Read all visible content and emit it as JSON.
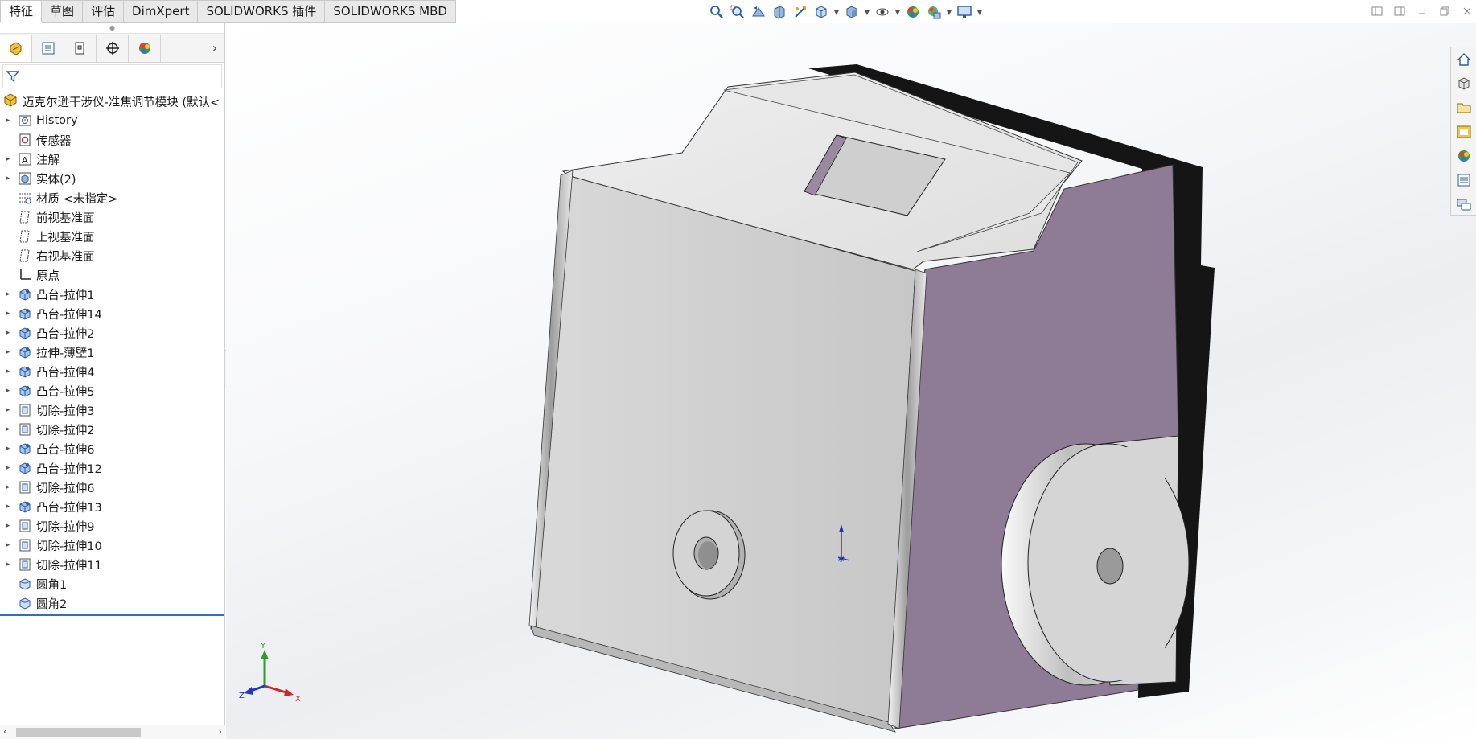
{
  "tabs": [
    "特征",
    "草图",
    "评估",
    "DimXpert",
    "SOLIDWORKS 插件",
    "SOLIDWORKS MBD"
  ],
  "active_tab": "特征",
  "view_toolbar": {
    "icons": [
      "zoom-to-fit-icon",
      "zoom-to-area-icon",
      "previous-view-icon",
      "section-view-icon",
      "dynamic-annotation-icon",
      "view-orientation-icon",
      "display-style-icon",
      "hide-show-items-icon",
      "edit-appearance-icon",
      "apply-scene-icon",
      "view-settings-icon"
    ]
  },
  "feature_tree": {
    "root": "迈克尔逊干涉仪-准焦调节模块  (默认<",
    "items": [
      {
        "label": "History",
        "expandable": true,
        "icon": "history-folder-icon"
      },
      {
        "label": "传感器",
        "expandable": false,
        "icon": "sensor-icon"
      },
      {
        "label": "注解",
        "expandable": true,
        "icon": "annotation-icon"
      },
      {
        "label": "实体(2)",
        "expandable": true,
        "icon": "solid-bodies-icon"
      },
      {
        "label": "材质 <未指定>",
        "expandable": false,
        "icon": "material-icon"
      },
      {
        "label": "前视基准面",
        "expandable": false,
        "icon": "plane-icon"
      },
      {
        "label": "上视基准面",
        "expandable": false,
        "icon": "plane-icon"
      },
      {
        "label": "右视基准面",
        "expandable": false,
        "icon": "plane-icon"
      },
      {
        "label": "原点",
        "expandable": false,
        "icon": "origin-icon"
      },
      {
        "label": "凸台-拉伸1",
        "expandable": true,
        "icon": "boss-extrude-icon"
      },
      {
        "label": "凸台-拉伸14",
        "expandable": true,
        "icon": "boss-extrude-icon"
      },
      {
        "label": "凸台-拉伸2",
        "expandable": true,
        "icon": "boss-extrude-icon"
      },
      {
        "label": "拉伸-薄壁1",
        "expandable": true,
        "icon": "boss-extrude-icon"
      },
      {
        "label": "凸台-拉伸4",
        "expandable": true,
        "icon": "boss-extrude-icon"
      },
      {
        "label": "凸台-拉伸5",
        "expandable": true,
        "icon": "boss-extrude-icon"
      },
      {
        "label": "切除-拉伸3",
        "expandable": true,
        "icon": "cut-extrude-icon"
      },
      {
        "label": "切除-拉伸2",
        "expandable": true,
        "icon": "cut-extrude-icon"
      },
      {
        "label": "凸台-拉伸6",
        "expandable": true,
        "icon": "boss-extrude-icon"
      },
      {
        "label": "凸台-拉伸12",
        "expandable": true,
        "icon": "boss-extrude-icon"
      },
      {
        "label": "切除-拉伸6",
        "expandable": true,
        "icon": "cut-extrude-icon"
      },
      {
        "label": "凸台-拉伸13",
        "expandable": true,
        "icon": "boss-extrude-icon"
      },
      {
        "label": "切除-拉伸9",
        "expandable": true,
        "icon": "cut-extrude-icon"
      },
      {
        "label": "切除-拉伸10",
        "expandable": true,
        "icon": "cut-extrude-icon"
      },
      {
        "label": "切除-拉伸11",
        "expandable": true,
        "icon": "cut-extrude-icon"
      },
      {
        "label": "圆角1",
        "expandable": false,
        "icon": "fillet-icon"
      },
      {
        "label": "圆角2",
        "expandable": false,
        "icon": "fillet-icon"
      }
    ]
  },
  "triad": {
    "x": "X",
    "y": "Y",
    "z": "Z"
  },
  "colors": {
    "part_face": "#d3d3d3",
    "part_side": "#8e7b95",
    "part_back": "#151515",
    "rollback_bar": "#2f6fbf"
  }
}
